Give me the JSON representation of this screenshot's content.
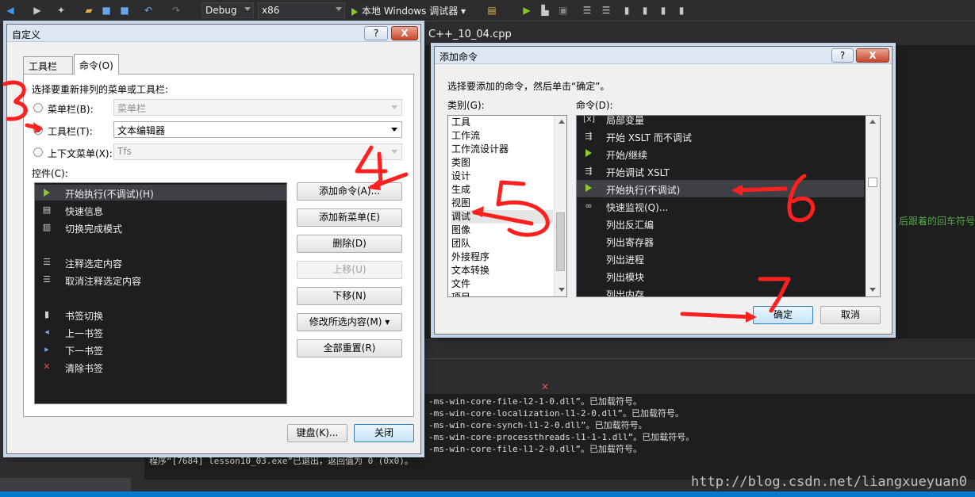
{
  "ide": {
    "config": "Debug",
    "platform": "x86",
    "run_label": "本地 Windows 调试器",
    "editor_tab": "C++_10_04.cpp",
    "editor_line": "后跟着的回车符号",
    "output_lines": [
      "-ms-win-core-file-l2-1-0.dll”。已加载符号。",
      "-ms-win-core-localization-l1-2-0.dll”。已加载符号。",
      "-ms-win-core-synch-l1-2-0.dll”。已加载符号。",
      "-ms-win-core-processthreads-l1-1-1.dll”。已加载符号。",
      "-ms-win-core-file-l1-2-0.dll”。已加载符号。",
      "程序“[7684] lesson10_03.exe”已退出，返回值为 0 (0x0)。"
    ],
    "watermark": "http://blog.csdn.net/liangxueyuan0"
  },
  "customize": {
    "title": "自定义",
    "help": "?",
    "close": "X",
    "tabs": [
      "工具栏(S)",
      "命令(O)"
    ],
    "section_label": "选择要重新排列的菜单或工具栏:",
    "menubar_label": "菜单栏(B):",
    "menubar_value": "菜单栏",
    "toolbar_label": "工具栏(T):",
    "toolbar_value": "文本编辑器",
    "context_label": "上下文菜单(X):",
    "context_value": "Tfs",
    "controls_label": "控件(C):",
    "controls": [
      {
        "label": "开始执行(不调试)(H)",
        "icon": "play-icon"
      },
      {
        "label": "快速信息",
        "icon": "quick-info-icon"
      },
      {
        "label": "切换完成模式",
        "icon": "completion-mode-icon"
      },
      {
        "label": "注释选定内容",
        "icon": "comment-icon"
      },
      {
        "label": "取消注释选定内容",
        "icon": "uncomment-icon"
      },
      {
        "label": "书签切换",
        "icon": "bookmark-icon"
      },
      {
        "label": "上一书签",
        "icon": "prev-bookmark-icon"
      },
      {
        "label": "下一书签",
        "icon": "next-bookmark-icon"
      },
      {
        "label": "清除书签",
        "icon": "clear-bookmarks-icon"
      }
    ],
    "buttons": {
      "add_command": "添加命令(A)...",
      "add_menu": "添加新菜单(E)",
      "delete": "删除(D)",
      "move_up": "上移(U)",
      "move_down": "下移(N)",
      "modify": "修改所选内容(M) ▾",
      "reset_all": "全部重置(R)",
      "keyboard": "键盘(K)...",
      "close": "关闭"
    }
  },
  "add_command": {
    "title": "添加命令",
    "help": "?",
    "close": "X",
    "instruction": "选择要添加的命令，然后单击“确定”。",
    "category_label": "类别(G):",
    "command_label": "命令(D):",
    "categories": [
      "工具",
      "工作流",
      "工作流设计器",
      "类图",
      "设计",
      "生成",
      "视图",
      "调试",
      "图像",
      "团队",
      "外接程序",
      "文本转换",
      "文件",
      "项目"
    ],
    "selected_category": "调试",
    "commands": [
      {
        "label": "局部变量",
        "icon": "locals-icon"
      },
      {
        "label": "开始 XSLT 而不调试",
        "icon": "xslt-icon"
      },
      {
        "label": "开始/继续",
        "icon": "play-icon"
      },
      {
        "label": "开始调试 XSLT",
        "icon": "xslt-debug-icon"
      },
      {
        "label": "开始执行(不调试)",
        "icon": "play-icon"
      },
      {
        "label": "快速监视(Q)...",
        "icon": "glasses-icon"
      },
      {
        "label": "列出反汇编",
        "icon": ""
      },
      {
        "label": "列出寄存器",
        "icon": ""
      },
      {
        "label": "列出进程",
        "icon": ""
      },
      {
        "label": "列出模块",
        "icon": ""
      },
      {
        "label": "列出内存",
        "icon": ""
      }
    ],
    "ok": "确定",
    "cancel": "取消"
  },
  "annotations": {
    "n3": "3",
    "n4": "4",
    "n5": "5",
    "n6": "6",
    "n7": "7",
    "color": "#ff2020"
  }
}
